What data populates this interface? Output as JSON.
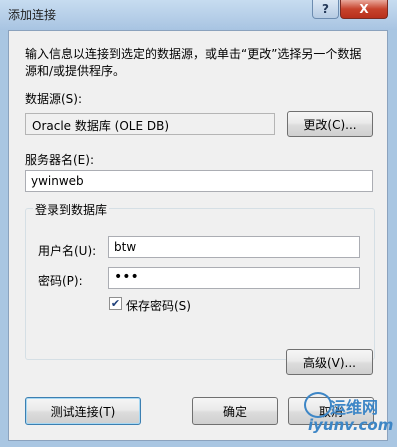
{
  "window": {
    "title": "添加连接",
    "help_label": "?",
    "close_label": "X"
  },
  "intro_text_line1": "输入信息以连接到选定的数据源，或单击“更改”选择另一个数据",
  "intro_text_line2": "源和/或提供程序。",
  "datasource": {
    "label": "数据源(S):",
    "value": "Oracle 数据库 (OLE DB)",
    "change_button": "更改(C)..."
  },
  "server": {
    "label": "服务器名(E):",
    "value": "ywinweb"
  },
  "login": {
    "group_label": "登录到数据库",
    "username_label": "用户名(U):",
    "username_value": "btw",
    "password_label": "密码(P):",
    "password_value": "•••",
    "save_password_label": "保存密码(S)",
    "save_password_checked": true
  },
  "advanced_button": "高级(V)...",
  "footer": {
    "test_button": "测试连接(T)",
    "ok_button": "确定",
    "cancel_button": "取消"
  },
  "watermark": {
    "top": "运维网",
    "bottom": "iyunv.com"
  }
}
